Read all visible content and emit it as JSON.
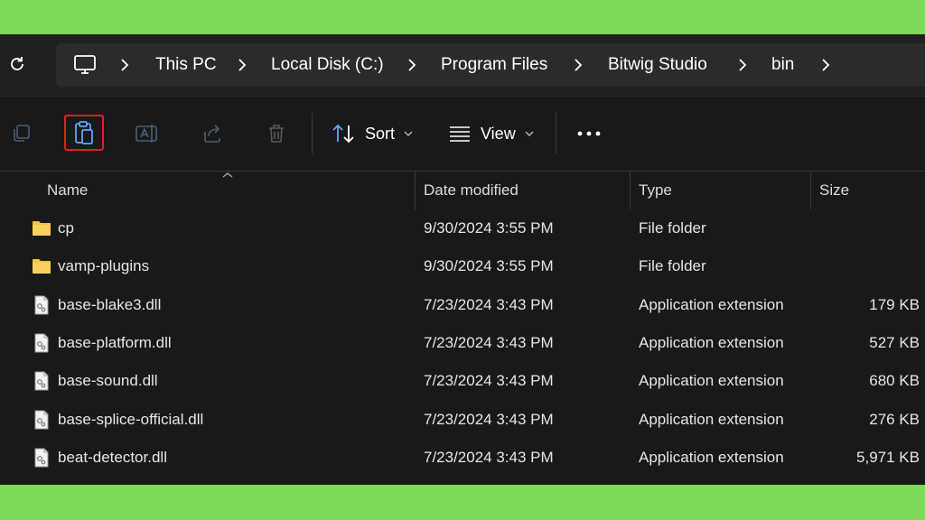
{
  "address": {
    "crumbs": [
      "This PC",
      "Local Disk (C:)",
      "Program Files",
      "Bitwig Studio",
      "bin"
    ]
  },
  "toolbar": {
    "sort_label": "Sort",
    "view_label": "View",
    "highlighted": "paste-button",
    "highlight_color": "#e02020"
  },
  "columns": {
    "name": "Name",
    "date": "Date modified",
    "type": "Type",
    "size": "Size"
  },
  "files": [
    {
      "name": "cp",
      "date": "9/30/2024 3:55 PM",
      "type": "File folder",
      "size": "",
      "kind": "folder"
    },
    {
      "name": "vamp-plugins",
      "date": "9/30/2024 3:55 PM",
      "type": "File folder",
      "size": "",
      "kind": "folder"
    },
    {
      "name": "base-blake3.dll",
      "date": "7/23/2024 3:43 PM",
      "type": "Application extension",
      "size": "179 KB",
      "kind": "dll"
    },
    {
      "name": "base-platform.dll",
      "date": "7/23/2024 3:43 PM",
      "type": "Application extension",
      "size": "527 KB",
      "kind": "dll"
    },
    {
      "name": "base-sound.dll",
      "date": "7/23/2024 3:43 PM",
      "type": "Application extension",
      "size": "680 KB",
      "kind": "dll"
    },
    {
      "name": "base-splice-official.dll",
      "date": "7/23/2024 3:43 PM",
      "type": "Application extension",
      "size": "276 KB",
      "kind": "dll"
    },
    {
      "name": "beat-detector.dll",
      "date": "7/23/2024 3:43 PM",
      "type": "Application extension",
      "size": "5,971 KB",
      "kind": "dll"
    }
  ],
  "colors": {
    "frame": "#7ed957",
    "folder": "#f4c542",
    "accent_blue": "#60a5fa"
  }
}
